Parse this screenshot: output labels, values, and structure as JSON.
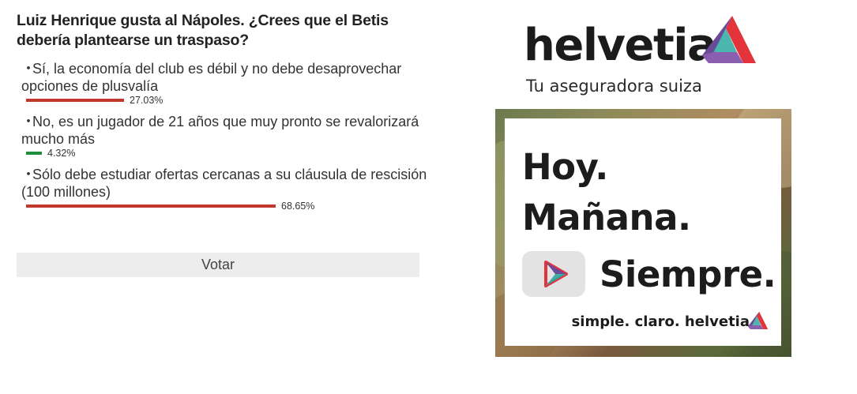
{
  "poll": {
    "title": "Luiz Henrique gusta al Nápoles. ¿Crees que el Betis debería plantearse un traspaso?",
    "options": [
      {
        "bullet": "・",
        "text": "Sí, la economía del club es débil y no debe desaprovechar opciones de plusvalía",
        "percent": "27.03%",
        "fraction": 0.2703,
        "color": "#c0392b"
      },
      {
        "bullet": "・",
        "text": "No, es un jugador de 21 años que muy pronto se revalorizará mucho más",
        "percent": "4.32%",
        "fraction": 0.0432,
        "color": "#1e8f3e"
      },
      {
        "bullet": "・",
        "text": "Sólo debe estudiar ofertas cercanas a su cláusula de rescisión (100 millones)",
        "percent": "68.65%",
        "fraction": 0.6865,
        "color": "#c0392b"
      }
    ],
    "vote_label": "Votar"
  },
  "brand": {
    "name": "helvetia",
    "tagline": "Tu aseguradora suiza"
  },
  "ad": {
    "line1": "Hoy.",
    "line2": "Mañana.",
    "line3": "Siempre.",
    "footer": "simple. claro. helvetia"
  },
  "colors": {
    "accent_red": "#c0392b",
    "accent_green": "#1e8f3e",
    "button_bg": "#ededed",
    "logo_red": "#e2343a",
    "logo_purple": "#6b4a9a",
    "logo_teal": "#2aa9a0"
  },
  "icons": {
    "brand_mark": "helvetia-logo-icon",
    "play": "play-icon"
  }
}
